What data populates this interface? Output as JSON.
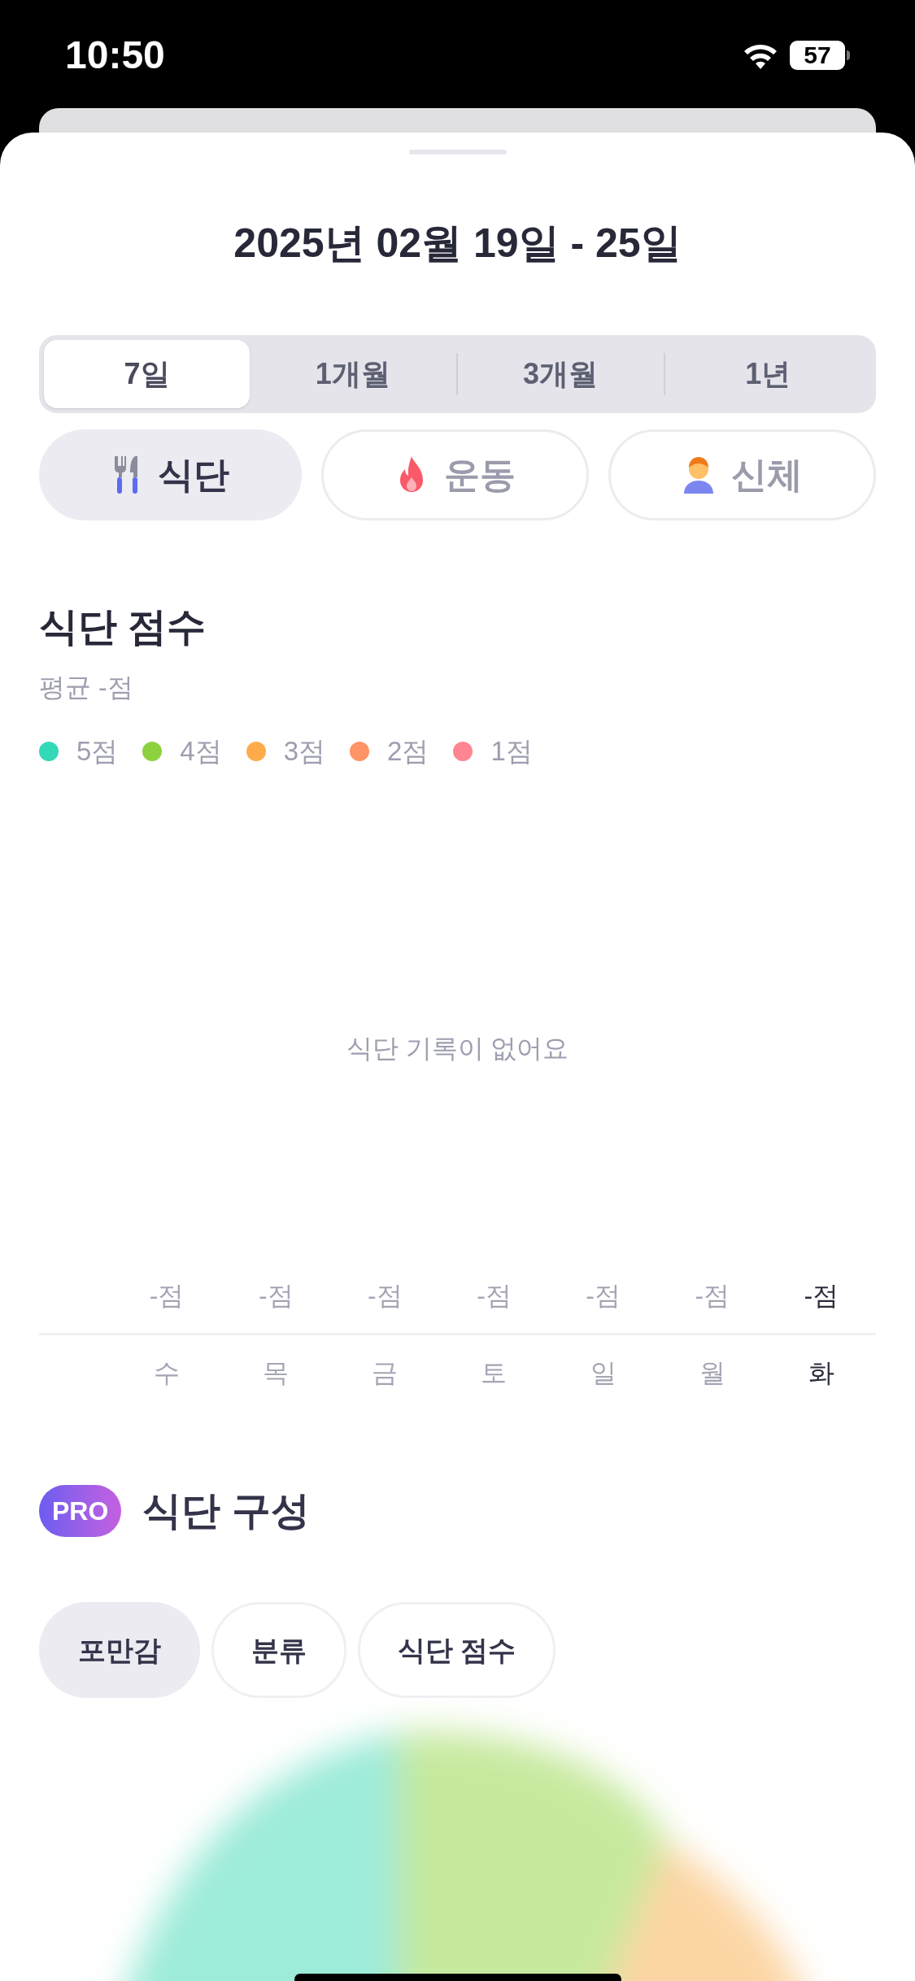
{
  "status_bar": {
    "time": "10:50",
    "battery": "57"
  },
  "header": {
    "title": "2025년 02월 19일 - 25일"
  },
  "period_tabs": [
    {
      "label": "7일",
      "selected": true
    },
    {
      "label": "1개월",
      "selected": false
    },
    {
      "label": "3개월",
      "selected": false
    },
    {
      "label": "1년",
      "selected": false
    }
  ],
  "category_tabs": [
    {
      "label": "식단",
      "kind": "meal",
      "selected": true
    },
    {
      "label": "운동",
      "kind": "exercise",
      "selected": false
    },
    {
      "label": "신체",
      "kind": "body",
      "selected": false
    }
  ],
  "score_section": {
    "title": "식단 점수",
    "average": "평균 -점",
    "legend": [
      {
        "label": "5점",
        "color": "#33d9b8"
      },
      {
        "label": "4점",
        "color": "#8ed13f"
      },
      {
        "label": "3점",
        "color": "#ffab4a"
      },
      {
        "label": "2점",
        "color": "#ff9466"
      },
      {
        "label": "1점",
        "color": "#ff8591"
      }
    ],
    "empty_message": "식단 기록이 없어요",
    "days": [
      {
        "score": "-점",
        "day": "수",
        "selected": false
      },
      {
        "score": "-점",
        "day": "목",
        "selected": false
      },
      {
        "score": "-점",
        "day": "금",
        "selected": false
      },
      {
        "score": "-점",
        "day": "토",
        "selected": false
      },
      {
        "score": "-점",
        "day": "일",
        "selected": false
      },
      {
        "score": "-점",
        "day": "월",
        "selected": false
      },
      {
        "score": "-점",
        "day": "화",
        "selected": true
      }
    ]
  },
  "composition_section": {
    "badge": "PRO",
    "title": "식단 구성",
    "filters": [
      {
        "label": "포만감",
        "selected": true
      },
      {
        "label": "분류",
        "selected": false
      },
      {
        "label": "식단 점수",
        "selected": false
      }
    ]
  }
}
